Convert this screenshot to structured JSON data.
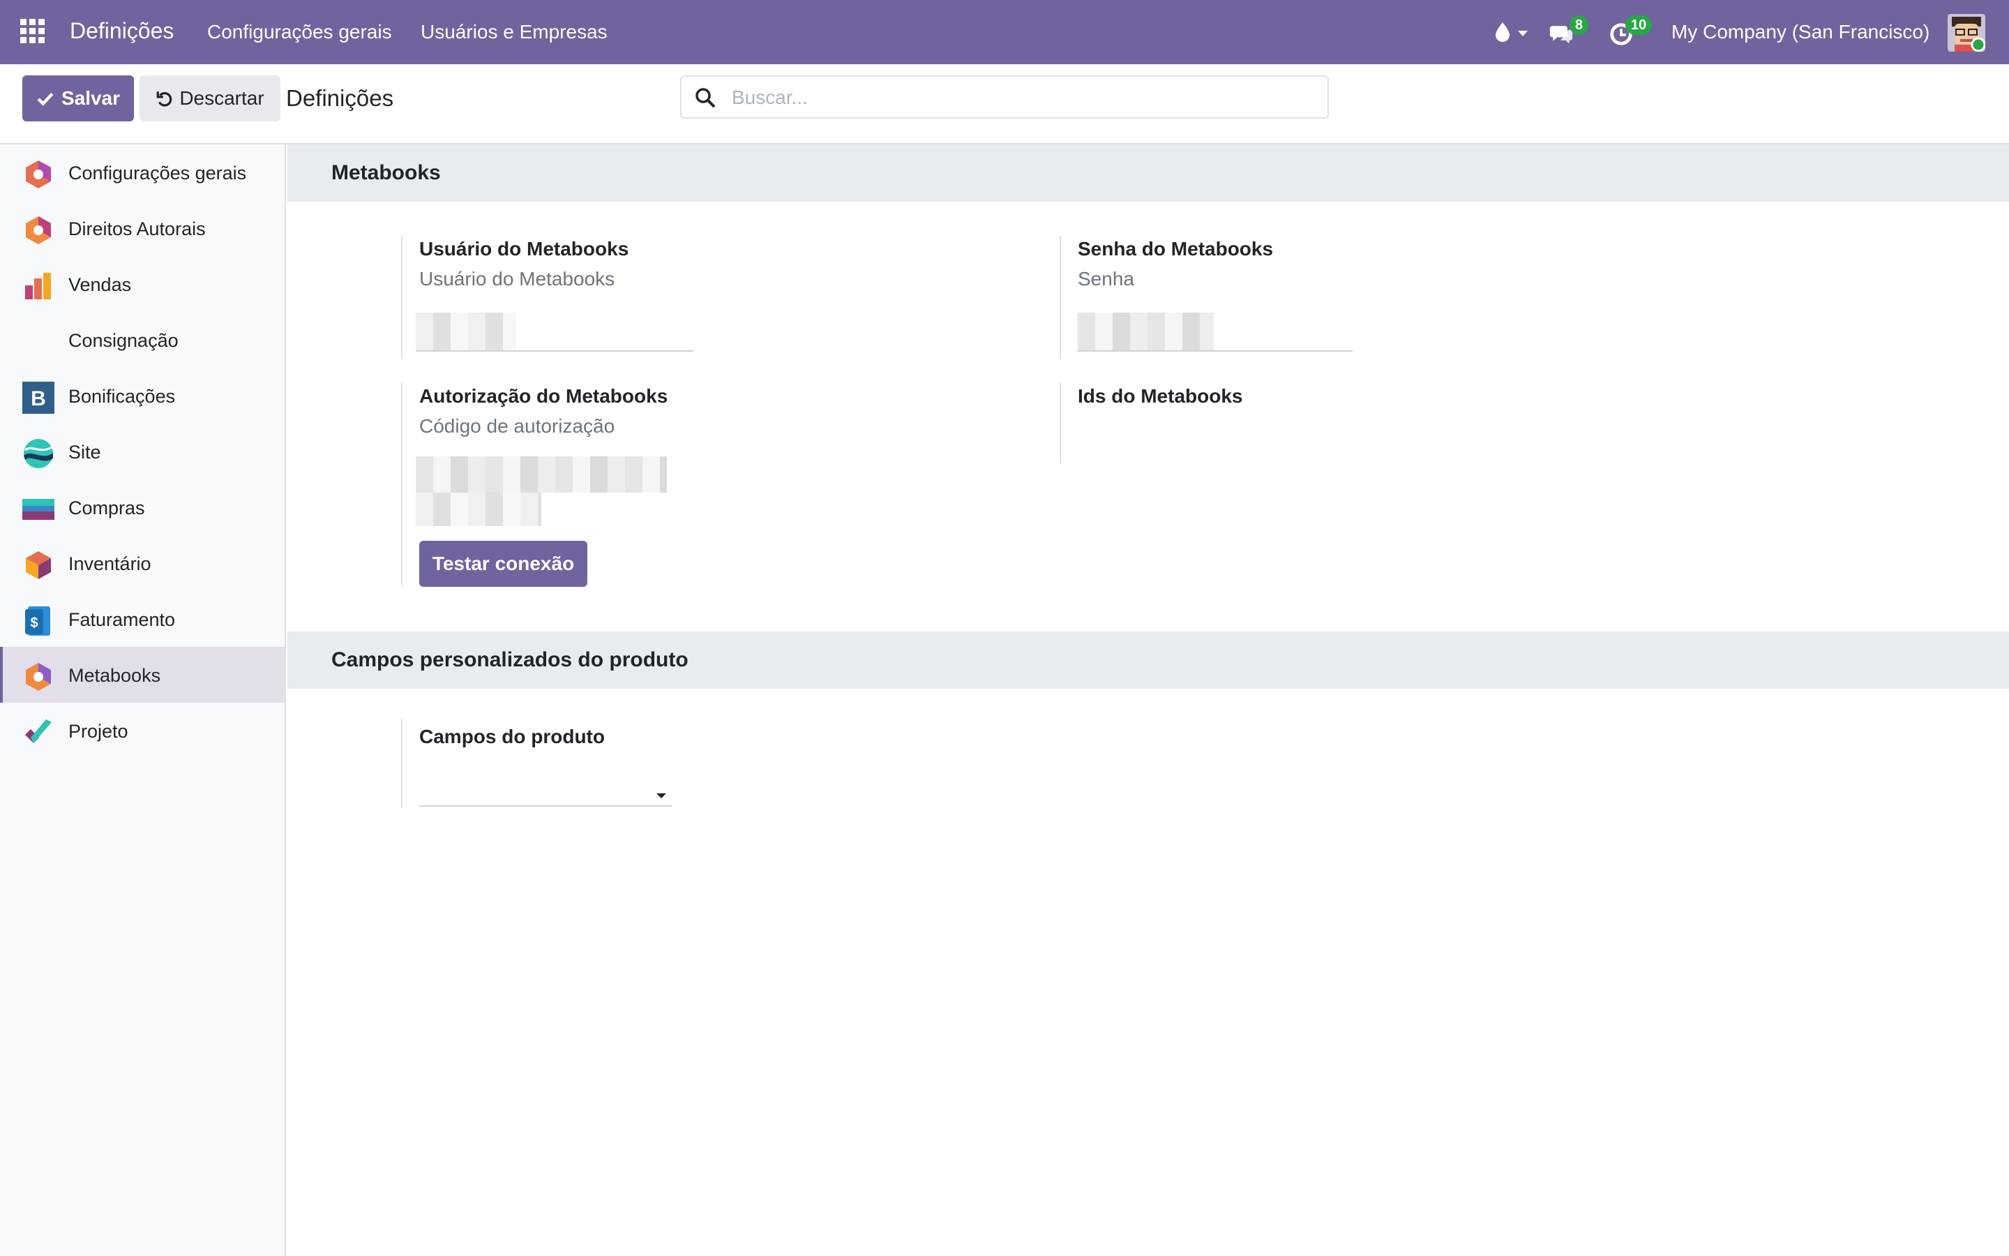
{
  "navbar": {
    "app_title": "Definições",
    "menu": [
      "Configurações gerais",
      "Usuários e Empresas"
    ],
    "chat_count": "8",
    "activity_count": "10",
    "company": "My Company (San Francisco)"
  },
  "control_panel": {
    "save_label": "Salvar",
    "discard_label": "Descartar",
    "title": "Definições",
    "search_placeholder": "Buscar..."
  },
  "sidebar": {
    "items": [
      {
        "label": "Configurações gerais",
        "icon": "settings-app-icon"
      },
      {
        "label": "Direitos Autorais",
        "icon": "copyright-app-icon"
      },
      {
        "label": "Vendas",
        "icon": "sales-app-icon"
      },
      {
        "label": "Consignação",
        "icon": ""
      },
      {
        "label": "Bonificações",
        "icon": "bonus-app-icon"
      },
      {
        "label": "Site",
        "icon": "website-app-icon"
      },
      {
        "label": "Compras",
        "icon": "purchase-app-icon"
      },
      {
        "label": "Inventário",
        "icon": "inventory-app-icon"
      },
      {
        "label": "Faturamento",
        "icon": "invoicing-app-icon"
      },
      {
        "label": "Metabooks",
        "icon": "metabooks-app-icon",
        "active": true
      },
      {
        "label": "Projeto",
        "icon": "project-app-icon"
      }
    ]
  },
  "main": {
    "section1": {
      "title": "Metabooks",
      "user": {
        "label": "Usuário do Metabooks",
        "help": "Usuário do Metabooks"
      },
      "password": {
        "label": "Senha do Metabooks",
        "help": "Senha"
      },
      "auth": {
        "label": "Autorização do Metabooks",
        "help": "Código de autorização"
      },
      "ids": {
        "label": "Ids do Metabooks"
      },
      "test_button": "Testar conexão"
    },
    "section2": {
      "title": "Campos personalizados do produto",
      "product_fields": {
        "label": "Campos do produto",
        "value": ""
      }
    }
  },
  "colors": {
    "brand": "#71639e",
    "badge": "#28a745",
    "section_bg": "#e9ecef",
    "sidebar_bg": "#f8f9fa"
  }
}
